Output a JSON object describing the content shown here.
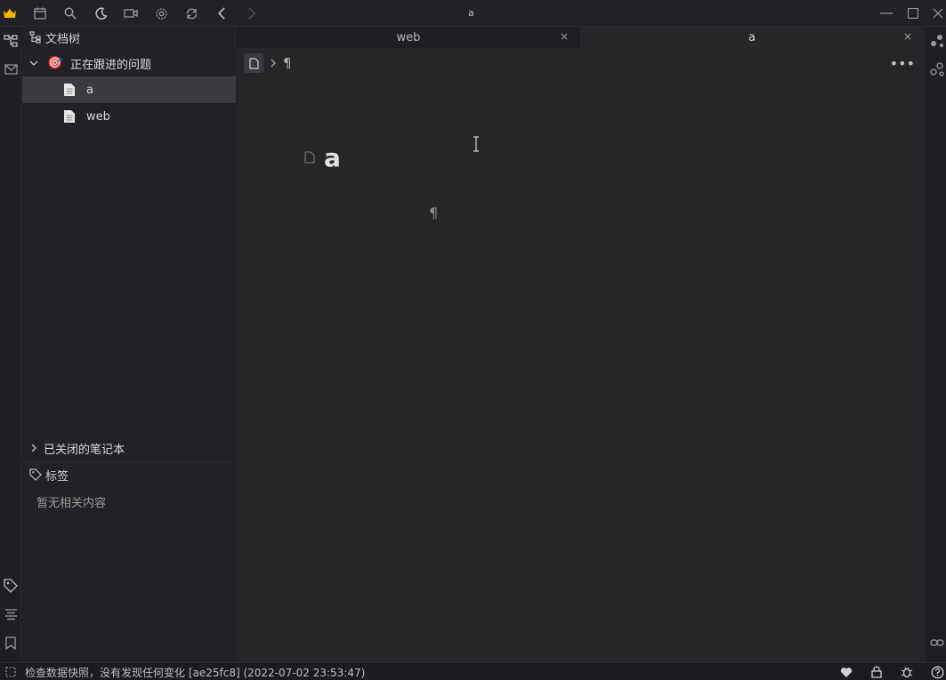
{
  "window": {
    "title": "a"
  },
  "sidebar": {
    "header": "文档树",
    "notebook": {
      "name": "正在跟进的问题",
      "emoji": "🎯"
    },
    "items": [
      {
        "label": "a",
        "selected": true
      },
      {
        "label": "web",
        "selected": false
      }
    ],
    "closed_notebooks": "已关闭的笔记本",
    "tags_header": "标签",
    "tags_empty": "暂无相关内容"
  },
  "tabs": [
    {
      "label": "web",
      "active": false,
      "close": "×"
    },
    {
      "label": "a",
      "active": true,
      "close": "×"
    }
  ],
  "editor": {
    "breadcrumb_para": "¶",
    "more": "•••",
    "doc_title": "a",
    "para_mark": "¶"
  },
  "statusbar": {
    "message": "检查数据快照，没有发现任何变化 [ae25fc8] (2022-07-02 23:53:47)"
  },
  "colors": {
    "bg": "#1e1f22",
    "panel": "#212225",
    "editor": "#252628",
    "selected": "#3a3b3f",
    "accent": "#f5b400"
  },
  "icons": {
    "top": [
      "crown-icon",
      "calendar-icon",
      "search-icon",
      "moon-icon",
      "video-icon",
      "gear-icon",
      "sync-icon",
      "back-icon",
      "forward-icon"
    ],
    "left": [
      "tree-icon",
      "inbox-icon",
      "tag-icon",
      "outline-icon",
      "bookmark-icon"
    ],
    "right": [
      "graph-icon",
      "global-graph-icon",
      "backlink-icon"
    ],
    "status": [
      "heart-icon",
      "lock-icon",
      "bug-icon",
      "help-icon"
    ]
  }
}
